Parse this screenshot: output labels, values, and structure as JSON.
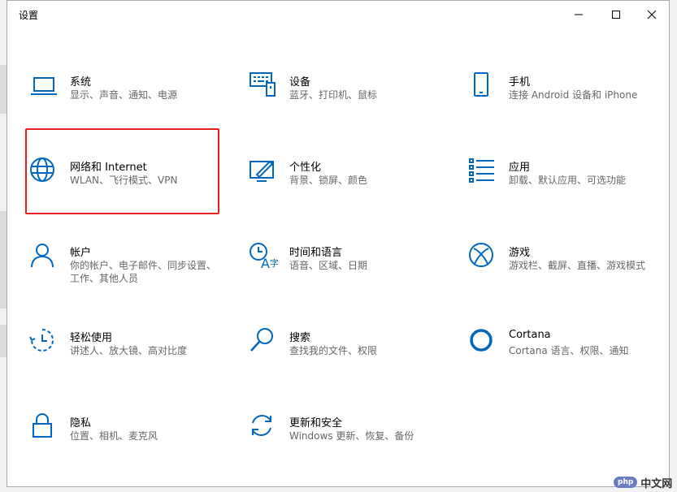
{
  "window": {
    "title": "设置",
    "controls": {
      "minimize": "minimize-icon",
      "maximize": "maximize-icon",
      "close": "close-icon"
    }
  },
  "accent_color": "#0067c0",
  "highlight_color": "#e52020",
  "tiles": [
    {
      "title": "系统",
      "desc": "显示、声音、通知、电源",
      "icon": "laptop-icon"
    },
    {
      "title": "设备",
      "desc": "蓝牙、打印机、鼠标",
      "icon": "keyboard-device-icon"
    },
    {
      "title": "手机",
      "desc": "连接 Android 设备和 iPhone",
      "icon": "phone-icon"
    },
    {
      "title": "网络和 Internet",
      "desc": "WLAN、飞行模式、VPN",
      "icon": "globe-icon"
    },
    {
      "title": "个性化",
      "desc": "背景、锁屏、颜色",
      "icon": "personalization-icon"
    },
    {
      "title": "应用",
      "desc": "卸载、默认应用、可选功能",
      "icon": "apps-list-icon"
    },
    {
      "title": "帐户",
      "desc": "你的帐户、电子邮件、同步设置、工作、其他人员",
      "icon": "person-icon"
    },
    {
      "title": "时间和语言",
      "desc": "语音、区域、日期",
      "icon": "time-language-icon"
    },
    {
      "title": "游戏",
      "desc": "游戏栏、截屏、直播、游戏模式",
      "icon": "xbox-icon"
    },
    {
      "title": "轻松使用",
      "desc": "讲述人、放大镜、高对比度",
      "icon": "ease-of-access-icon"
    },
    {
      "title": "搜索",
      "desc": "查找我的文件、权限",
      "icon": "search-icon"
    },
    {
      "title": "Cortana",
      "desc": "Cortana 语言、权限、通知",
      "icon": "cortana-icon"
    },
    {
      "title": "隐私",
      "desc": "位置、相机、麦克风",
      "icon": "lock-icon"
    },
    {
      "title": "更新和安全",
      "desc": "Windows 更新、恢复、备份",
      "icon": "update-icon"
    }
  ],
  "watermark": {
    "logo": "php",
    "text": "中文网"
  }
}
